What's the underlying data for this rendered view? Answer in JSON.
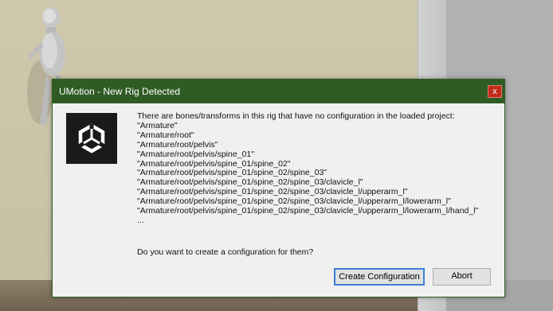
{
  "dialog": {
    "title": "UMotion - New Rig Detected",
    "close_label": "x",
    "message_header": "There are bones/transforms in this rig that have no configuration in the loaded project:",
    "bones": [
      "\"Armature\"",
      "\"Armature/root\"",
      "\"Armature/root/pelvis\"",
      "\"Armature/root/pelvis/spine_01\"",
      "\"Armature/root/pelvis/spine_01/spine_02\"",
      "\"Armature/root/pelvis/spine_01/spine_02/spine_03\"",
      "\"Armature/root/pelvis/spine_01/spine_02/spine_03/clavicle_l\"",
      "\"Armature/root/pelvis/spine_01/spine_02/spine_03/clavicle_l/upperarm_l\"",
      "\"Armature/root/pelvis/spine_01/spine_02/spine_03/clavicle_l/upperarm_l/lowerarm_l\"",
      "\"Armature/root/pelvis/spine_01/spine_02/spine_03/clavicle_l/upperarm_l/lowerarm_l/hand_l\""
    ],
    "ellipsis": "...",
    "question": "Do you want to create a configuration for them?",
    "create_button": "Create Configuration",
    "abort_button": "Abort",
    "logo_icon": "unity-logo-icon"
  },
  "colors": {
    "titlebar": "#2f5b24",
    "close": "#c42b1c",
    "focus": "#3c7fd8"
  }
}
